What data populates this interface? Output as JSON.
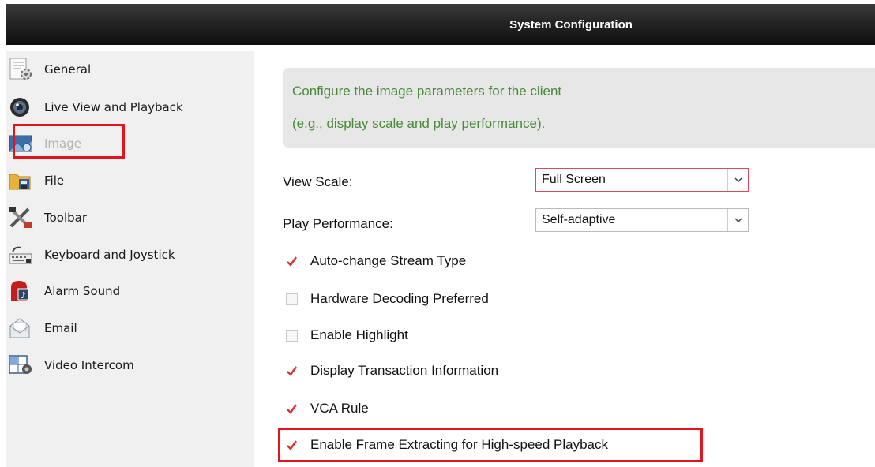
{
  "window": {
    "title": "System Configuration"
  },
  "sidebar": {
    "items": [
      {
        "label": "General",
        "icon": "general-settings-icon"
      },
      {
        "label": "Live View and Playback",
        "icon": "camera-lens-icon"
      },
      {
        "label": "Image",
        "icon": "image-icon",
        "state": "selected"
      },
      {
        "label": "File",
        "icon": "folder-icon"
      },
      {
        "label": "Toolbar",
        "icon": "tools-icon"
      },
      {
        "label": "Keyboard and Joystick",
        "icon": "keyboard-icon"
      },
      {
        "label": "Alarm Sound",
        "icon": "alarm-sound-icon"
      },
      {
        "label": "Email",
        "icon": "email-icon"
      },
      {
        "label": "Video Intercom",
        "icon": "video-intercom-icon"
      }
    ]
  },
  "main": {
    "description": {
      "line1": "Configure the image parameters for the client",
      "line2": "(e.g., display scale and play performance)."
    },
    "view_scale": {
      "label": "View Scale:",
      "value": "Full Screen"
    },
    "play_performance": {
      "label": "Play Performance:",
      "value": "Self-adaptive"
    },
    "options": [
      {
        "label": "Auto-change Stream Type",
        "checked": true
      },
      {
        "label": "Hardware Decoding Preferred",
        "checked": false
      },
      {
        "label": "Enable Highlight",
        "checked": false
      },
      {
        "label": "Display Transaction Information",
        "checked": true
      },
      {
        "label": "VCA Rule",
        "checked": true
      },
      {
        "label": "Enable Frame Extracting for High-speed Playback",
        "checked": true
      }
    ]
  },
  "colors": {
    "highlight": "#e3141c",
    "description_text": "#4a8a3a",
    "check_mark": "#d8322e",
    "title_bar": "#1f1f1f"
  }
}
